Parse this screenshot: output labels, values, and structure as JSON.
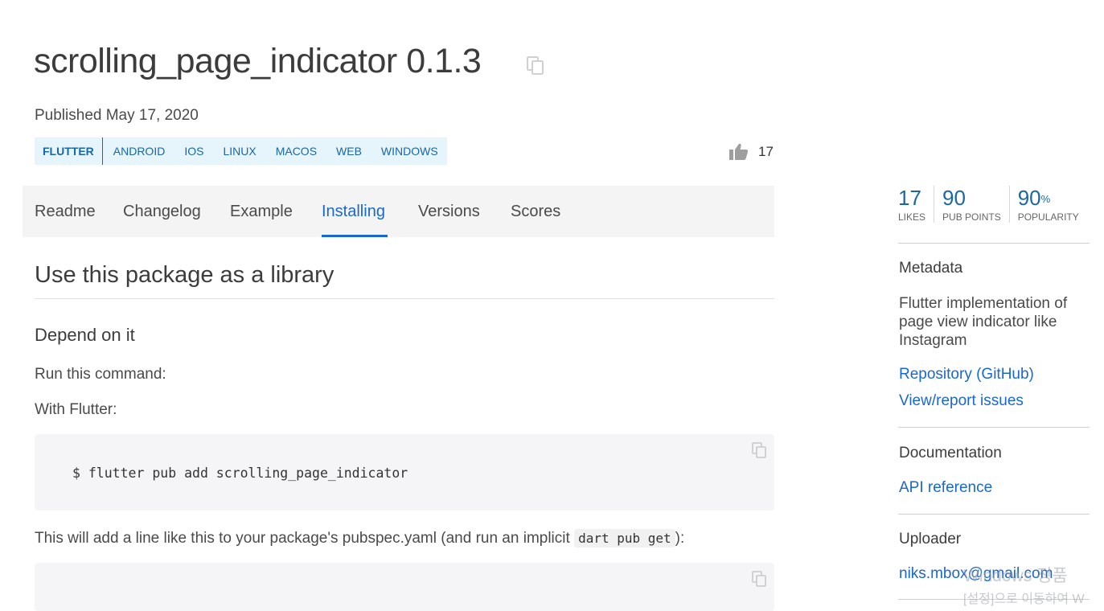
{
  "package": {
    "title": "scrolling_page_indicator 0.1.3",
    "published": "Published May 17, 2020",
    "sdk": "FLUTTER",
    "platforms": [
      "ANDROID",
      "IOS",
      "LINUX",
      "MACOS",
      "WEB",
      "WINDOWS"
    ],
    "likes": "17"
  },
  "tabs": [
    "Readme",
    "Changelog",
    "Example",
    "Installing",
    "Versions",
    "Scores"
  ],
  "active_tab": "Installing",
  "content": {
    "heading": "Use this package as a library",
    "subheading": "Depend on it",
    "run_command": "Run this command:",
    "with_flutter": "With Flutter:",
    "command": "$ flutter pub add scrolling_page_indicator",
    "pubspec_note_before": "This will add a line like this to your package's pubspec.yaml (and run an implicit",
    "pubspec_note_code": "dart pub get",
    "pubspec_note_after": "):"
  },
  "sidebar": {
    "stats": [
      {
        "value": "17",
        "suffix": "",
        "label": "LIKES"
      },
      {
        "value": "90",
        "suffix": "",
        "label": "PUB POINTS"
      },
      {
        "value": "90",
        "suffix": "%",
        "label": "POPULARITY"
      }
    ],
    "metadata_title": "Metadata",
    "description": "Flutter implementation of page view indicator like Instagram",
    "repository_link": "Repository (GitHub)",
    "issues_link": "View/report issues",
    "documentation_title": "Documentation",
    "api_link": "API reference",
    "uploader_title": "Uploader",
    "uploader_email": "niks.mbox@gmail.com"
  },
  "watermark": {
    "line1": "Windows 정품",
    "line2": "[설정]으로 이동하여 W"
  },
  "colors": {
    "link": "#1967d2",
    "platform_bg": "#e6f4fb",
    "stat_blue": "#1967a6"
  }
}
